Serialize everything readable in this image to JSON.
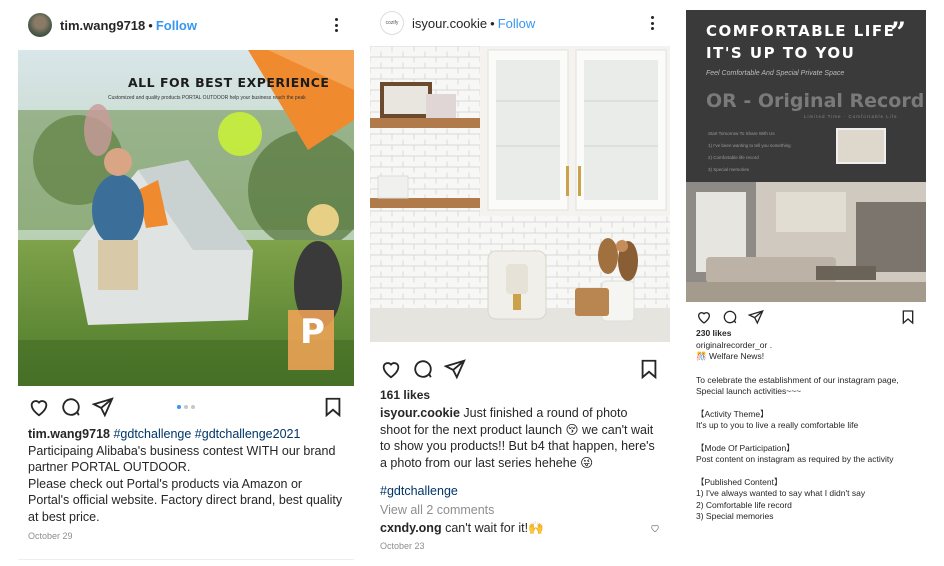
{
  "post1": {
    "username": "tim.wang9718",
    "follow": "Follow",
    "dot": "•",
    "banner_title": "ALL FOR BEST EXPERIENCE",
    "banner_sub": "Customized and quality products PORTAL OUTDOOR help your business reach the peak",
    "tent_logo": "P",
    "caption_user": "tim.wang9718",
    "caption_tags": "#gdtchallenge #gdtchallenge2021",
    "caption_text1": "Participaing Alibaba's business contest WITH our brand partner PORTAL OUTDOOR.",
    "caption_text2": "Please check out Portal's products via Amazon or Portal's official website. Factory direct brand, best quality at best price.",
    "date": "October 29"
  },
  "post2": {
    "avatar_text": "cozify",
    "username": "isyour.cookie",
    "follow": "Follow",
    "dot": "•",
    "likes": "161 likes",
    "caption_user": "isyour.cookie",
    "caption_text": "Just finished a round of photo shoot for the next product launch 😚 we can't wait to show you products!! But b4 that happen, here's a photo from our last series hehehe 😜",
    "hashtag": "#gdtchallenge",
    "view_comments": "View all 2 comments",
    "comment_user": "cxndy.ong",
    "comment_text": "can't wait for it!🙌",
    "date": "October 23"
  },
  "post3": {
    "poster_line1": "COMFORTABLE LIFE",
    "poster_line2": "IT'S UP TO YOU",
    "quote_mark": "”",
    "poster_tagline": "Feel Comfortable And Special Private Space",
    "poster_brand": "OR - Original Record",
    "poster_small": "Limited Time · Comfortable Life",
    "poster_list0": "Start Tomorrow To Share With Us",
    "poster_list1": "1) I've been wanting to tell you something",
    "poster_list2": "2) Comfortable life record",
    "poster_list3": "3) Special memories",
    "likes": "230 likes",
    "username": "originalrecorder_or .",
    "welfare": "🎊 Welfare News!",
    "p1": "To celebrate the establishment of our instagram page, Special launch activities~~~",
    "h1": "【Activity Theme】",
    "p2": "It's up to you to live a really comfortable life",
    "h2": "【Mode Of Participation】",
    "p3": "Post content on instagram as required by the activity",
    "h3": "【Published  Content】",
    "l1": "1) I've always wanted to say what I didn't say",
    "l2": "2) Comfortable life record",
    "l3": "3) Special memories"
  },
  "colors": {
    "link": "#3897f0",
    "poster_bg": "#3a3a3a",
    "banner_orange": "#ef8a2e"
  },
  "icons": [
    "heart-icon",
    "comment-icon",
    "share-icon",
    "bookmark-icon",
    "more-icon"
  ]
}
